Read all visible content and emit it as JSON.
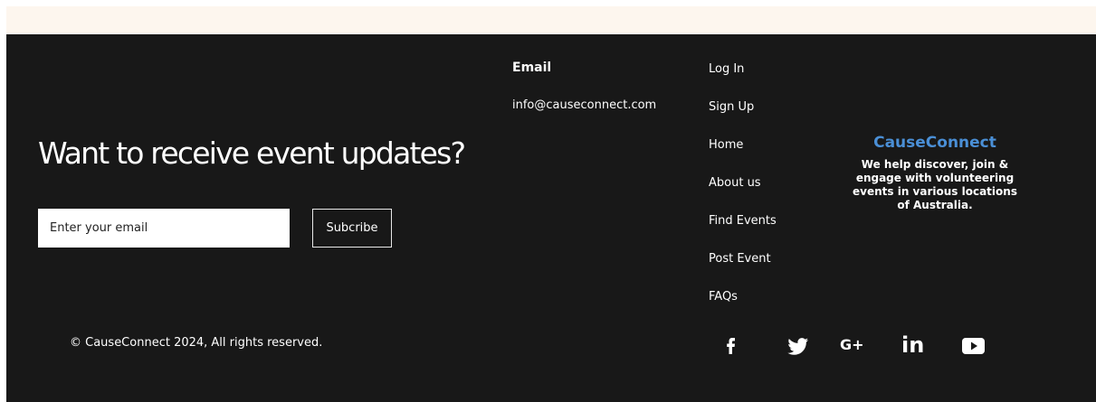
{
  "newsletter": {
    "headline": "Want to receive event updates?",
    "email_placeholder": "Enter your email",
    "subscribe_label": "Subcribe"
  },
  "contact": {
    "heading": "Email",
    "address": "info@causeconnect.com"
  },
  "nav": {
    "items": [
      {
        "label": "Log In"
      },
      {
        "label": "Sign Up"
      },
      {
        "label": "Home"
      },
      {
        "label": "About us"
      },
      {
        "label": "Find Events"
      },
      {
        "label": "Post Event"
      },
      {
        "label": "FAQs"
      }
    ]
  },
  "brand": {
    "name": "CauseConnect",
    "description": "We help discover, join & engage with volunteering events in various locations of Australia.",
    "accent_color": "#4a8fd6"
  },
  "social": {
    "icons": [
      "facebook-icon",
      "twitter-icon",
      "google-plus-icon",
      "linkedin-icon",
      "youtube-icon"
    ],
    "google_plus_text": "G+",
    "linkedin_text": "in"
  },
  "footer": {
    "copyright": "© CauseConnect 2024, All rights reserved.",
    "background_color": "#181818",
    "top_band_color": "#fdf6ee"
  }
}
